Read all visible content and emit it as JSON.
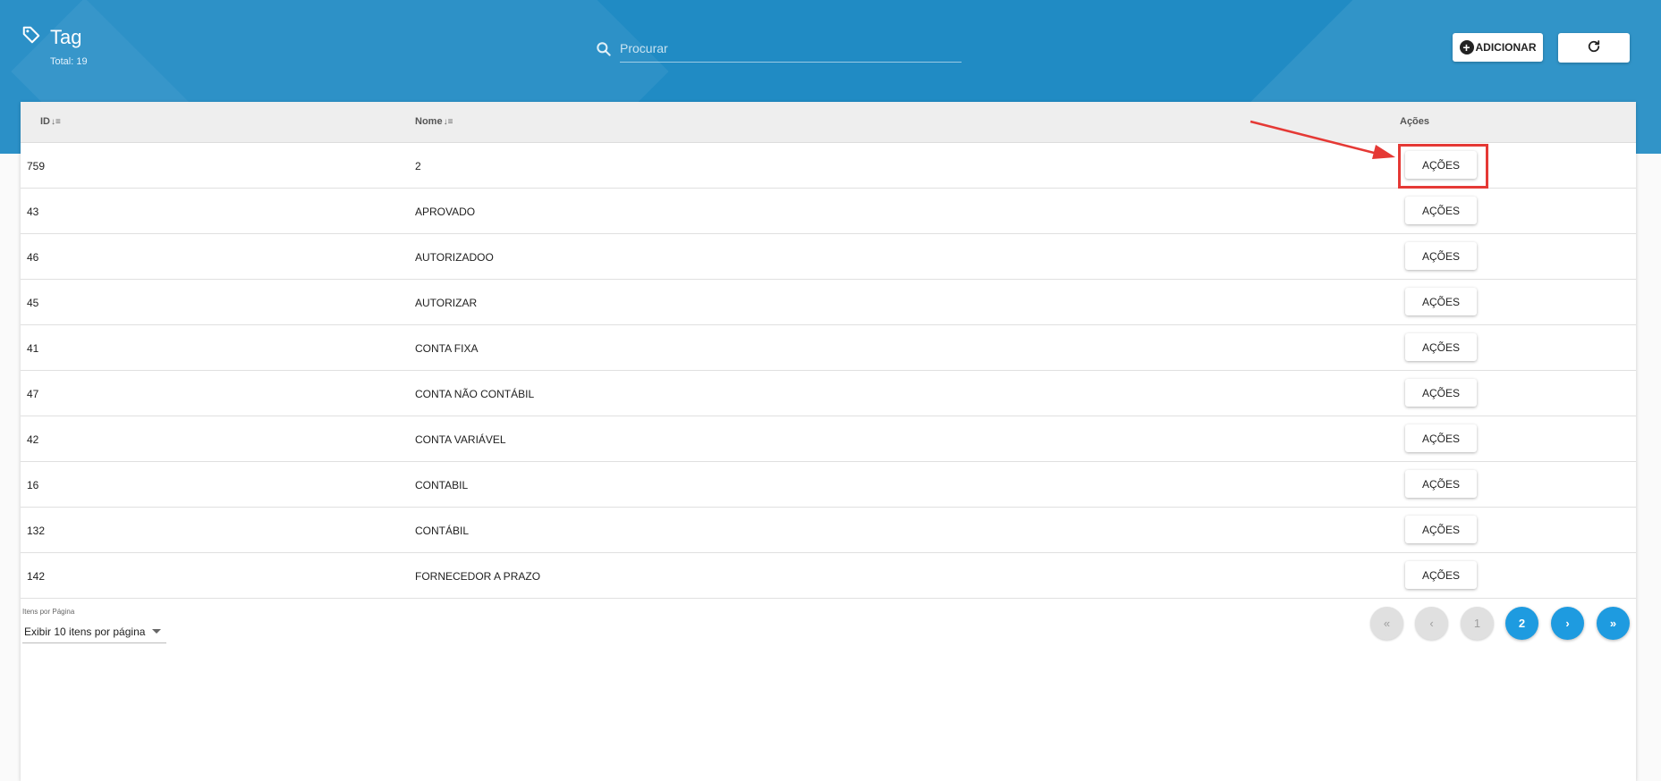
{
  "header": {
    "title": "Tag",
    "total_label": "Total: 19",
    "search_placeholder": "Procurar",
    "add_label": "ADICIONAR"
  },
  "table": {
    "columns": [
      "ID",
      "Nome",
      "Ações"
    ],
    "rows": [
      {
        "id": "759",
        "name": "2",
        "action": "AÇÕES"
      },
      {
        "id": "43",
        "name": "APROVADO",
        "action": "AÇÕES"
      },
      {
        "id": "46",
        "name": "AUTORIZADOO",
        "action": "AÇÕES"
      },
      {
        "id": "45",
        "name": "AUTORIZAR",
        "action": "AÇÕES"
      },
      {
        "id": "41",
        "name": "CONTA FIXA",
        "action": "AÇÕES"
      },
      {
        "id": "47",
        "name": "CONTA NÃO CONTÁBIL",
        "action": "AÇÕES"
      },
      {
        "id": "42",
        "name": "CONTA VARIÁVEL",
        "action": "AÇÕES"
      },
      {
        "id": "16",
        "name": "CONTABIL",
        "action": "AÇÕES"
      },
      {
        "id": "132",
        "name": "CONTÁBIL",
        "action": "AÇÕES"
      },
      {
        "id": "142",
        "name": "FORNECEDOR A PRAZO",
        "action": "AÇÕES"
      }
    ]
  },
  "footer": {
    "items_per_page_label": "Itens por Página",
    "items_per_page_value": "Exibir 10 itens por página",
    "pagination": {
      "first": "«",
      "prev": "‹",
      "pages": [
        "1",
        "2"
      ],
      "current_page": "2",
      "next": "›",
      "last": "»"
    }
  },
  "colors": {
    "header_bg": "#208bc4",
    "page_active": "#1e9be0",
    "highlight": "#e53935"
  }
}
